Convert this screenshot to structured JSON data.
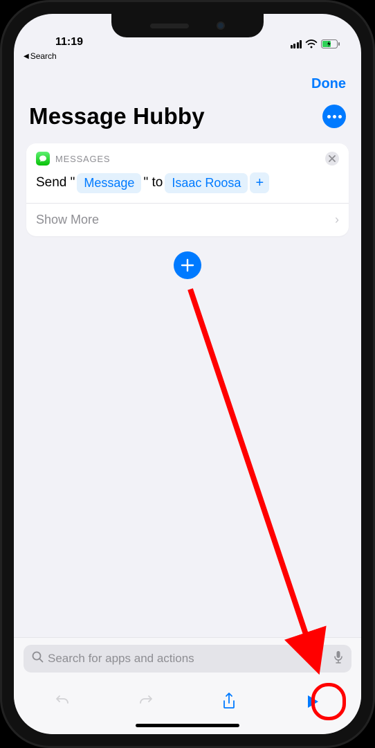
{
  "status": {
    "time": "11:19"
  },
  "back": {
    "label": "Search"
  },
  "nav": {
    "done": "Done"
  },
  "title": "Message Hubby",
  "action_card": {
    "app_label": "MESSAGES",
    "prefix_1": "Send \"",
    "message_token": "Message",
    "prefix_2": "\" to",
    "recipient_token": "Isaac Roosa",
    "show_more": "Show More"
  },
  "search": {
    "placeholder": "Search for apps and actions"
  }
}
